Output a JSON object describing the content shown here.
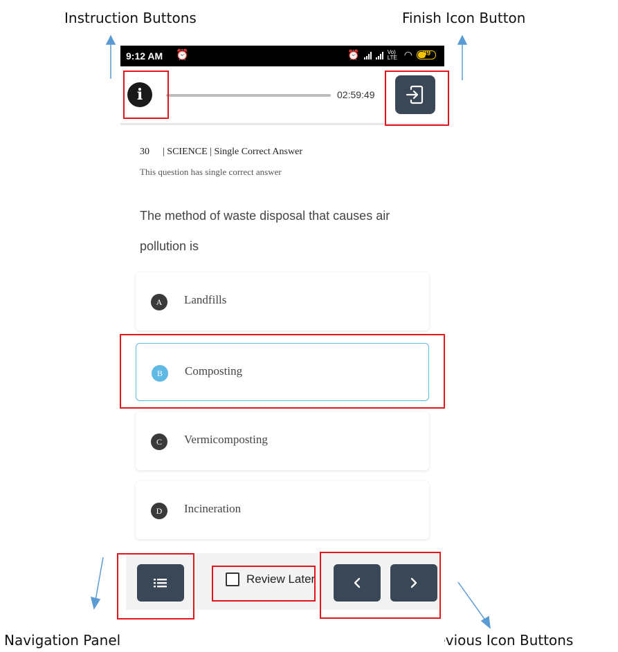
{
  "annotations": {
    "instruction_buttons": "Instruction Buttons",
    "finish_icon_button": "Finish Icon Button",
    "navigation_panel_icon_button": "Navigation Panel Icon Button",
    "next_previous_icon_buttons": "Next and Previous Icon Buttons",
    "highlight_color": "#e3141b",
    "arrow_color": "#5b9bd5"
  },
  "status_bar": {
    "time": "9:12 AM",
    "network_label": "Vo) LTE",
    "battery_level": "39"
  },
  "top_bar": {
    "info_icon": "info-icon",
    "timer": "02:59:49",
    "finish_icon": "exit-icon"
  },
  "question": {
    "number": "30",
    "subject_meta": "| SCIENCE | Single Correct Answer",
    "hint": "This question has single correct answer",
    "text": "The method of waste disposal that causes air pollution is"
  },
  "options": [
    {
      "letter": "A",
      "text": "Landfills",
      "selected": false
    },
    {
      "letter": "B",
      "text": "Composting",
      "selected": true
    },
    {
      "letter": "C",
      "text": "Vermicomposting",
      "selected": false
    },
    {
      "letter": "D",
      "text": "Incineration",
      "selected": false
    }
  ],
  "bottom_bar": {
    "nav_icon": "list-icon",
    "review_label": "Review Later",
    "review_checked": false,
    "prev_icon": "chevron-left-icon",
    "next_icon": "chevron-right-icon"
  },
  "colors": {
    "button_dark": "#3a4756",
    "selected_accent": "#5fb9e5"
  }
}
